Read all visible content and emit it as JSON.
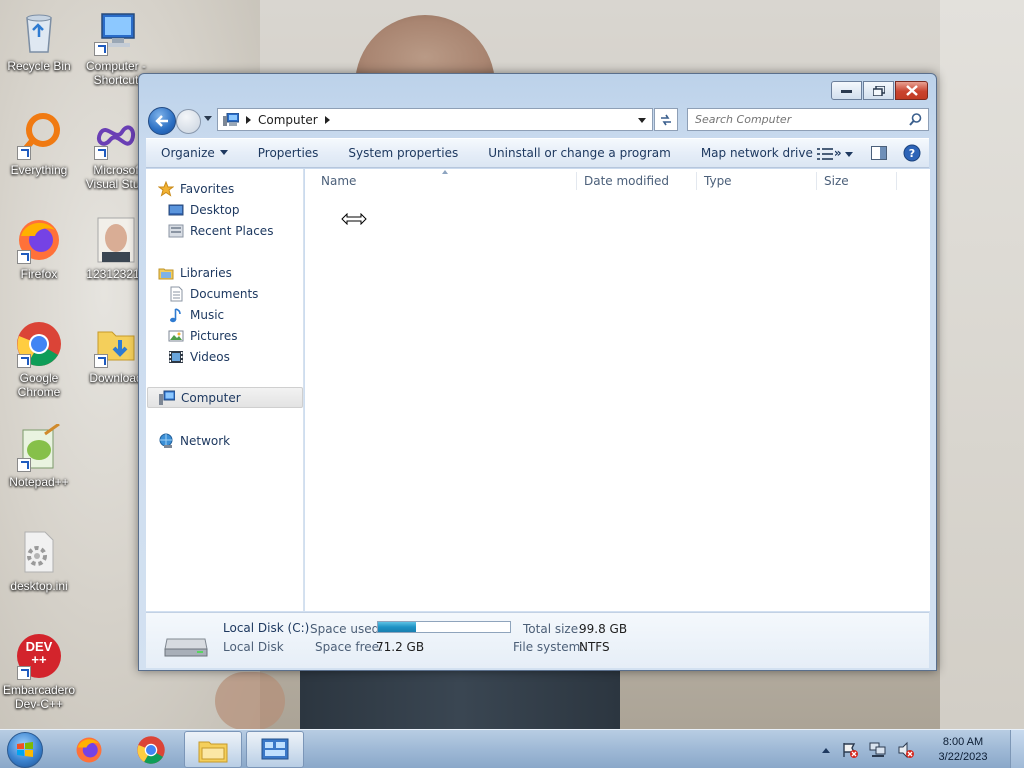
{
  "desktop": {
    "icons": [
      {
        "label": "Recycle Bin",
        "icon": "recycle-bin-icon"
      },
      {
        "label": "Computer -\nShortcut",
        "icon": "computer-shortcut-icon"
      },
      {
        "label": "Everything",
        "icon": "everything-icon"
      },
      {
        "label": "Microsof\nVisual Stud",
        "icon": "visual-studio-icon"
      },
      {
        "label": "Firefox",
        "icon": "firefox-icon"
      },
      {
        "label": "12312321.j",
        "icon": "photo-file-icon"
      },
      {
        "label": "Google\nChrome",
        "icon": "chrome-icon"
      },
      {
        "label": "Download",
        "icon": "downloads-folder-icon"
      },
      {
        "label": "Notepad++",
        "icon": "notepad-plus-plus-icon"
      },
      {
        "label": "desktop.ini",
        "icon": "settings-file-icon"
      },
      {
        "label": "Embarcadero\nDev-C++",
        "icon": "dev-cpp-icon"
      }
    ],
    "dev_logo_text": "DEV\n++"
  },
  "window": {
    "address": {
      "crumbs": [
        "Computer"
      ]
    },
    "search": {
      "placeholder": "Search Computer"
    },
    "toolbar": {
      "organize": "Organize",
      "properties": "Properties",
      "system_properties": "System properties",
      "uninstall": "Uninstall or change a program",
      "map_drive": "Map network drive",
      "more": "»"
    },
    "nav": {
      "favorites": "Favorites",
      "desktop": "Desktop",
      "recent": "Recent Places",
      "libraries": "Libraries",
      "documents": "Documents",
      "music": "Music",
      "pictures": "Pictures",
      "videos": "Videos",
      "computer": "Computer",
      "network": "Network"
    },
    "columns": [
      "Name",
      "Date modified",
      "Type",
      "Size"
    ],
    "details": {
      "drive_name": "Local Disk (C:)",
      "drive_type": "Local Disk",
      "space_used_label": "Space used:",
      "space_used_fraction": 0.29,
      "space_free_label": "Space free:",
      "space_free": "71.2 GB",
      "total_size_label": "Total size:",
      "total_size": "99.8 GB",
      "filesystem_label": "File system:",
      "filesystem": "NTFS"
    }
  },
  "taskbar": {
    "time": "8:00 AM",
    "date": "3/22/2023",
    "apps": [
      "firefox-icon",
      "chrome-icon",
      "explorer-icon",
      "control-panel-icon"
    ]
  },
  "colors": {
    "accent": "#2b6fc3",
    "space_bar": "#1f93c5"
  }
}
